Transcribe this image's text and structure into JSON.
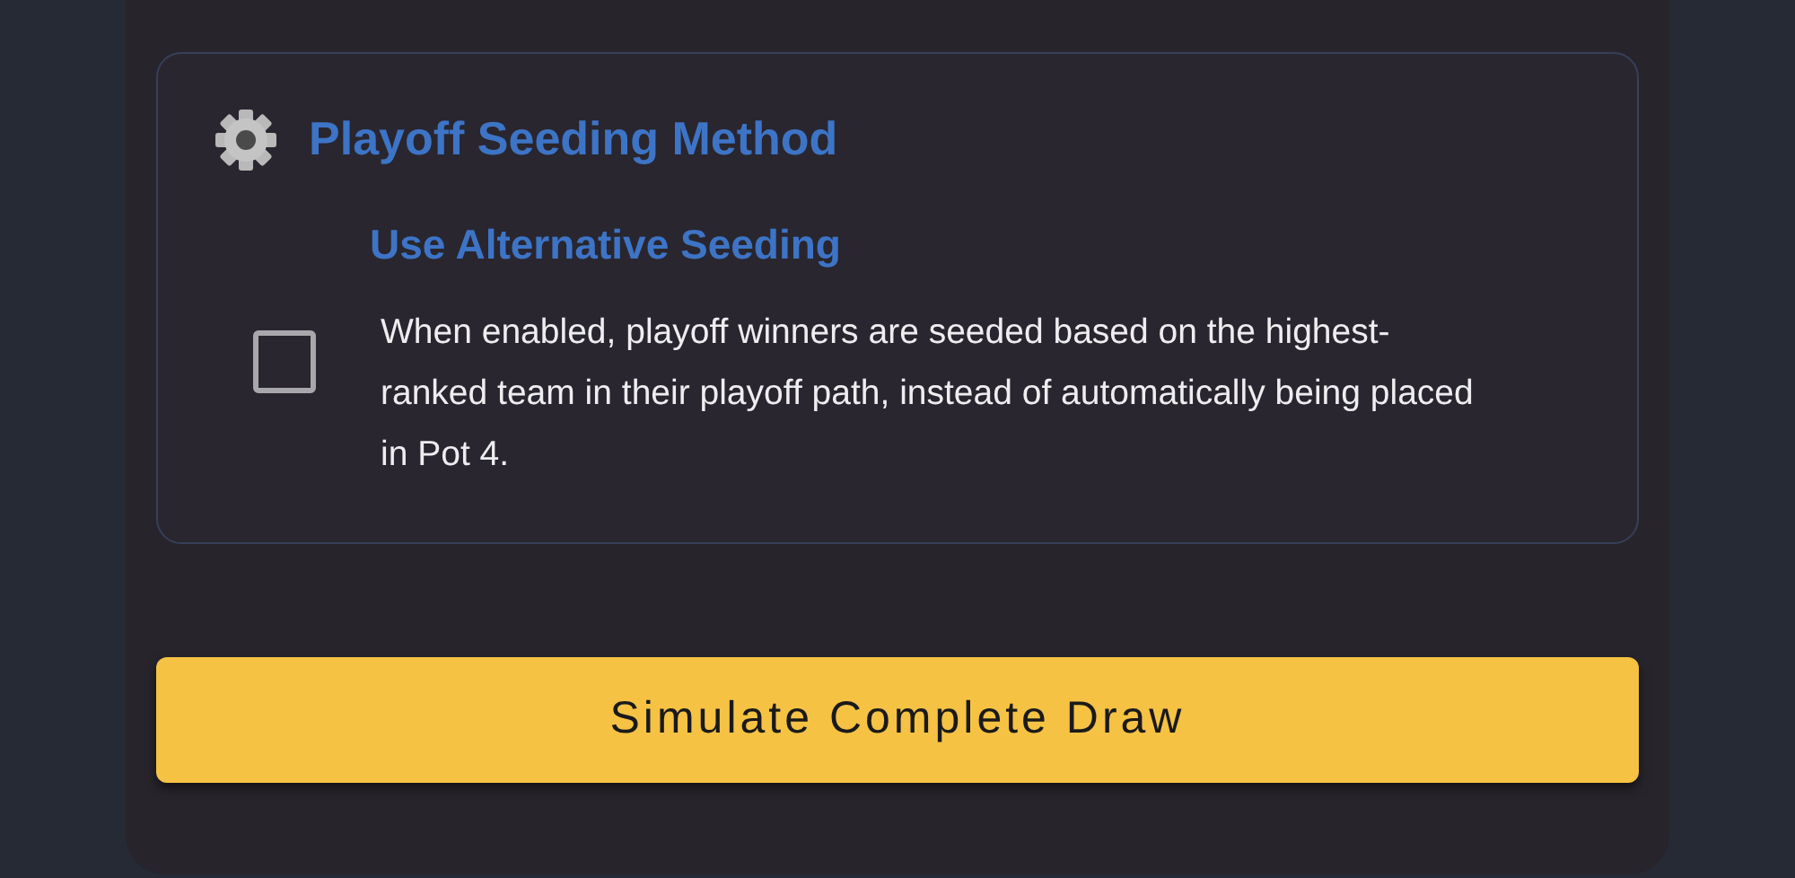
{
  "section": {
    "title": "Playoff Seeding Method",
    "option": {
      "label": "Use Alternative Seeding",
      "checked": false,
      "description": "When enabled, playoff winners are seeded based on the highest-ranked team in their playoff path, instead of automatically being placed in Pot 4."
    }
  },
  "button": {
    "label": "Simulate Complete Draw"
  }
}
